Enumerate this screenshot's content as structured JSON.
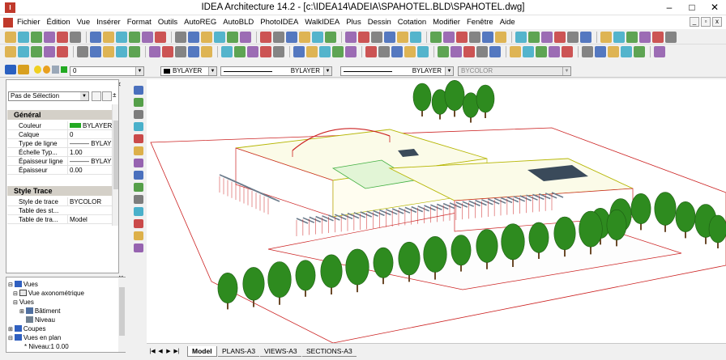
{
  "window": {
    "title": "IDEA Architecture 14.2  - [c:\\IDEA14\\ADEIA\\SPAHOTEL.BLD\\SPAHOTEL.dwg]",
    "minimize": "–",
    "maximize": "□",
    "close": "✕"
  },
  "menu": {
    "items": [
      "Fichier",
      "Édition",
      "Vue",
      "Insérer",
      "Format",
      "Outils",
      "AutoREG",
      "AutoBLD",
      "PhotoIDEA",
      "WalkIDEA",
      "Plus",
      "Dessin",
      "Cotation",
      "Modifier",
      "Fenêtre",
      "Aide"
    ],
    "mdi_min": "_",
    "mdi_restore": "▫",
    "mdi_close": "x"
  },
  "layerbar": {
    "layer_value": "0",
    "color_value": "BYLAYER",
    "linetype_value": "BYLAYER",
    "lineweight_value": "BYLAYER",
    "plotstyle_value": "BYCOLOR"
  },
  "properties": {
    "selection": "Pas de Sélection",
    "sections": [
      {
        "title": "Général",
        "rows": [
          {
            "key": "Couleur",
            "value": "BYLAYER"
          },
          {
            "key": "Calque",
            "value": "0"
          },
          {
            "key": "Type de ligne",
            "value": "——— BYLAYER"
          },
          {
            "key": "Échelle Typ...",
            "value": "1.00"
          },
          {
            "key": "Épaisseur ligne",
            "value": "——— BYLAYER"
          },
          {
            "key": "Épaisseur",
            "value": "0.00"
          }
        ]
      },
      {
        "title": "Style Trace",
        "rows": [
          {
            "key": "Style de trace",
            "value": "BYCOLOR"
          },
          {
            "key": "Table des st...",
            "value": ""
          },
          {
            "key": "Table de tra...",
            "value": "Model"
          }
        ]
      }
    ]
  },
  "tree": {
    "items": [
      "Vues",
      "Vue axonométrique",
      "Vues",
      "Bâtiment",
      "Niveau",
      "Coupes",
      "Vues en plan",
      "* Niveau:1 0.00"
    ]
  },
  "layout_tabs": {
    "nav": [
      "|◀",
      "◀",
      "▶",
      "▶|"
    ],
    "tabs": [
      "Model",
      "PLANS-A3",
      "VIEWS-A3",
      "SECTIONS-A3"
    ]
  },
  "colors": {
    "tree_green": "#2e8b1f",
    "building_yellow": "#b5b500",
    "outline_red": "#cc2222",
    "roof_dark": "#3a4a5a",
    "pergola_gray": "#6b7b8b",
    "toolbar_blue": "#2050b0",
    "toolbar_red": "#c02020"
  },
  "icons": {
    "app": "idea-logo-icon",
    "window": [
      "minimize-icon",
      "maximize-icon",
      "close-icon"
    ]
  }
}
